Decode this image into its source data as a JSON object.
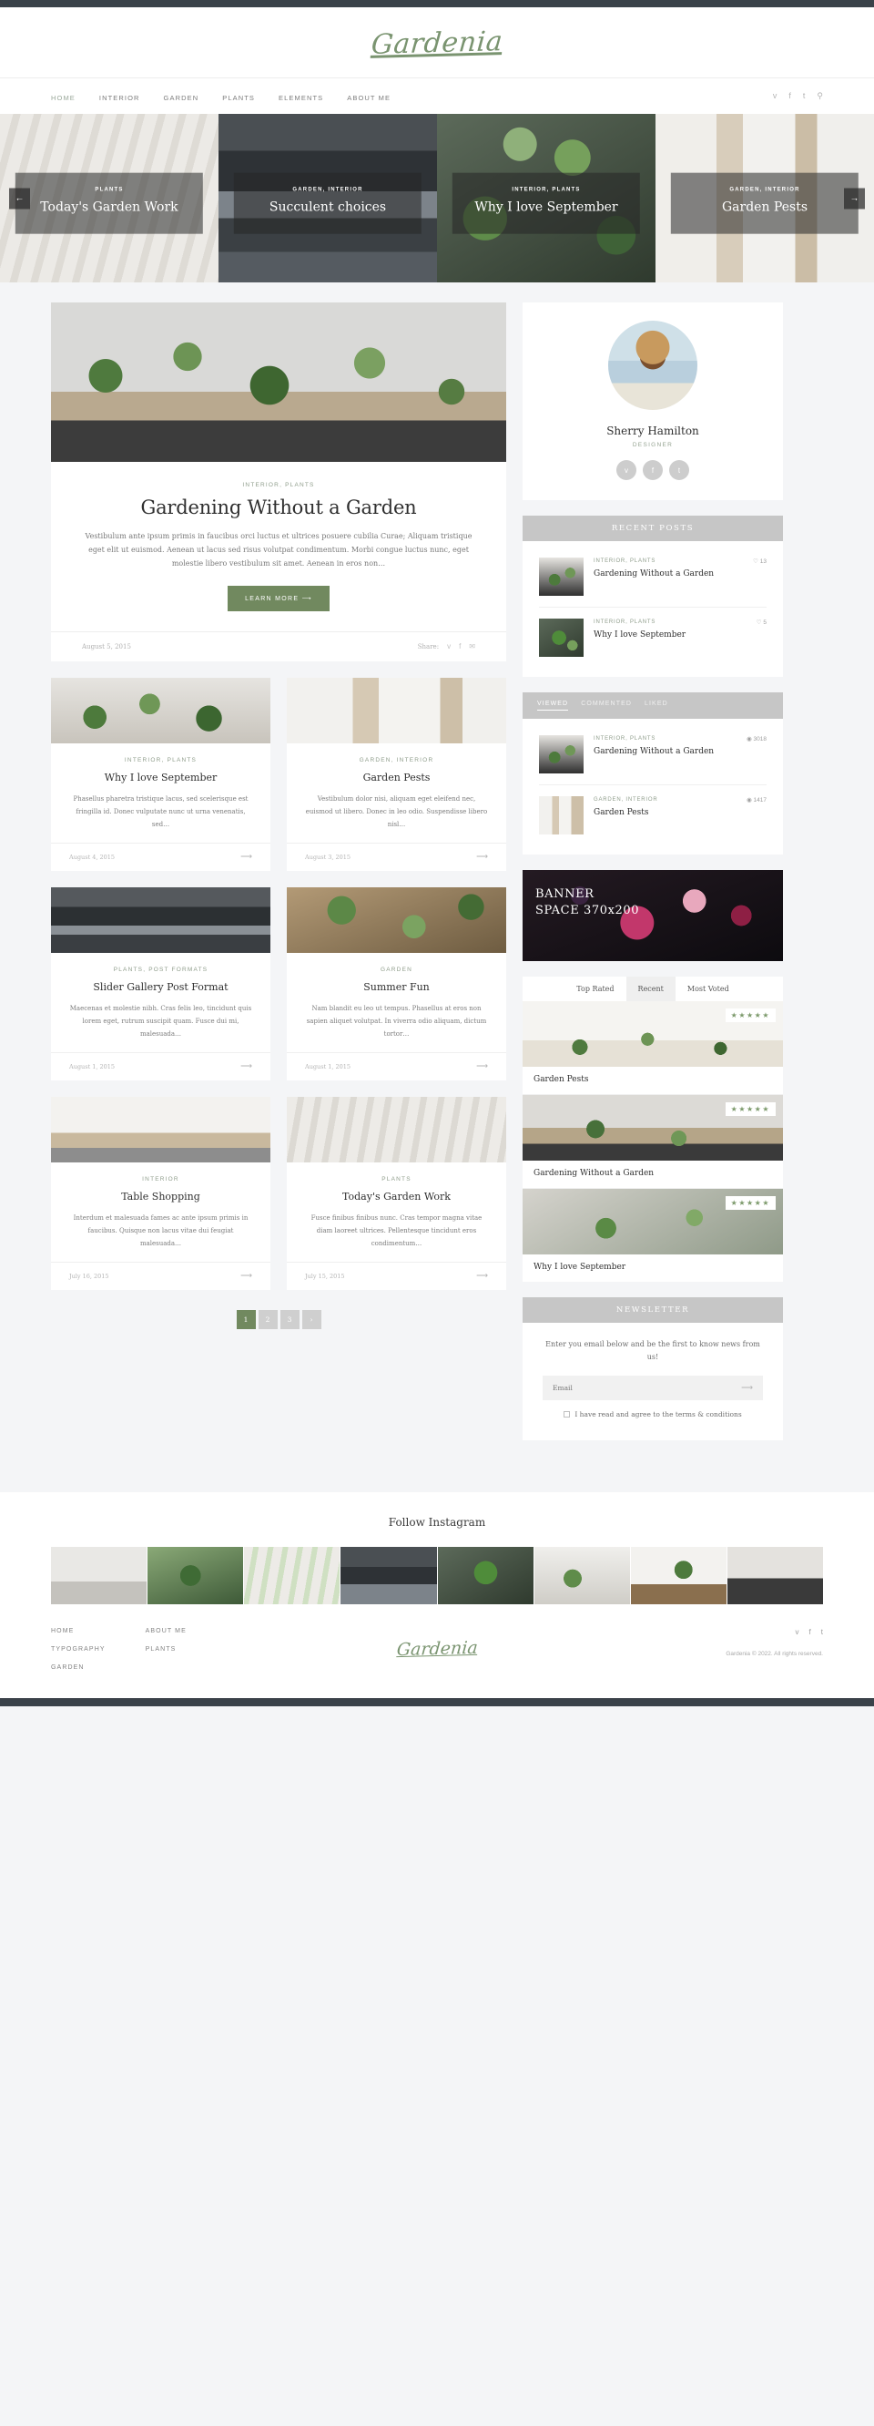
{
  "site": {
    "logo": "Gardenia",
    "footer_logo": "Gardenia"
  },
  "nav": {
    "items": [
      {
        "label": "HOME",
        "active": true
      },
      {
        "label": "INTERIOR",
        "active": false
      },
      {
        "label": "GARDEN",
        "active": false
      },
      {
        "label": "PLANTS",
        "active": false
      },
      {
        "label": "ELEMENTS",
        "active": false
      },
      {
        "label": "ABOUT ME",
        "active": false
      }
    ],
    "social": [
      {
        "name": "twitter-icon",
        "glyph": "ᴠ"
      },
      {
        "name": "facebook-icon",
        "glyph": "f"
      },
      {
        "name": "tumblr-icon",
        "glyph": "t"
      },
      {
        "name": "search-icon",
        "glyph": "⚲"
      }
    ]
  },
  "slider": {
    "prev_label": "←",
    "next_label": "→",
    "slides": [
      {
        "cat": "PLANTS",
        "title": "Today's Garden Work"
      },
      {
        "cat": "GARDEN, INTERIOR",
        "title": "Succulent choices"
      },
      {
        "cat": "INTERIOR, PLANTS",
        "title": "Why I love September"
      },
      {
        "cat": "GARDEN, INTERIOR",
        "title": "Garden Pests"
      }
    ]
  },
  "featured": {
    "cat": "INTERIOR, PLANTS",
    "title": "Gardening Without a Garden",
    "excerpt": "Vestibulum ante ipsum primis in faucibus orci luctus et ultrices posuere cubilia Curae; Aliquam tristique eget elit ut euismod. Aenean ut lacus sed risus volutpat condimentum. Morbi congue luctus nunc, eget molestie libero vestibulum sit amet. Aenean in eros non…",
    "button": "LEARN MORE  ⟶",
    "date": "August 5, 2015",
    "share_label": "Share:",
    "share": [
      {
        "name": "twitter-icon",
        "glyph": "ᴠ"
      },
      {
        "name": "facebook-icon",
        "glyph": "f"
      },
      {
        "name": "email-icon",
        "glyph": "✉"
      }
    ]
  },
  "posts": [
    {
      "cat": "INTERIOR, PLANTS",
      "title": "Why I love September",
      "excerpt": "Phasellus pharetra tristique lacus, sed scelerisque est fringilla id. Donec vulputate nunc ut urna venenatis, sed…",
      "date": "August 4, 2015",
      "arrow": "⟶"
    },
    {
      "cat": "GARDEN, INTERIOR",
      "title": "Garden Pests",
      "excerpt": "Vestibulum dolor nisi, aliquam eget eleifend nec, euismod ut libero. Donec in leo odio. Suspendisse libero nisl…",
      "date": "August 3, 2015",
      "arrow": "⟶"
    },
    {
      "cat": "PLANTS, POST FORMATS",
      "title": "Slider Gallery Post Format",
      "excerpt": "Maecenas et molestie nibh. Cras felis leo, tincidunt quis lorem eget, rutrum suscipit quam. Fusce dui mi, malesuada…",
      "date": "August 1, 2015",
      "arrow": "⟶"
    },
    {
      "cat": "GARDEN",
      "title": "Summer Fun",
      "excerpt": "Nam blandit eu leo ut tempus. Phasellus at eros non sapien aliquet volutpat. In viverra odio aliquam, dictum tortor…",
      "date": "August 1, 2015",
      "arrow": "⟶"
    },
    {
      "cat": "INTERIOR",
      "title": "Table Shopping",
      "excerpt": "Interdum et malesuada fames ac ante ipsum primis in faucibus. Quisque non lacus vitae dui feugiat malesuada…",
      "date": "July 16, 2015",
      "arrow": "⟶"
    },
    {
      "cat": "PLANTS",
      "title": "Today's Garden Work",
      "excerpt": "Fusce finibus finibus nunc. Cras tempor magna vitae diam laoreet ultrices. Pellentesque tincidunt eros condimentum…",
      "date": "July 15, 2015",
      "arrow": "⟶"
    }
  ],
  "pagination": {
    "pages": [
      "1",
      "2",
      "3",
      "›"
    ],
    "current": "1"
  },
  "sidebar": {
    "author": {
      "name": "Sherry Hamilton",
      "role": "DESIGNER",
      "social": [
        {
          "name": "twitter-icon",
          "glyph": "ᴠ"
        },
        {
          "name": "facebook-icon",
          "glyph": "f"
        },
        {
          "name": "tumblr-icon",
          "glyph": "t"
        }
      ]
    },
    "recent": {
      "title": "RECENT POSTS",
      "items": [
        {
          "cat": "INTERIOR, PLANTS",
          "title": "Gardening Without a Garden",
          "count": "♡ 13"
        },
        {
          "cat": "INTERIOR, PLANTS",
          "title": "Why I love September",
          "count": "♡ 5"
        }
      ]
    },
    "tabbed": {
      "tabs": [
        {
          "label": "VIEWED",
          "active": true
        },
        {
          "label": "COMMENTED",
          "active": false
        },
        {
          "label": "LIKED",
          "active": false
        }
      ],
      "items": [
        {
          "cat": "INTERIOR, PLANTS",
          "title": "Gardening Without a Garden",
          "count": "◉ 3018"
        },
        {
          "cat": "GARDEN, INTERIOR",
          "title": "Garden Pests",
          "count": "◉ 1417"
        }
      ]
    },
    "banner": {
      "line1": "BANNER",
      "line2": "SPACE 370x200"
    },
    "reviews": {
      "tabs": [
        {
          "label": "Top Rated",
          "active": true
        },
        {
          "label": "Recent",
          "active": false
        },
        {
          "label": "Most Voted",
          "active": false
        }
      ],
      "items": [
        {
          "title": "Garden Pests",
          "stars": "★★★★★"
        },
        {
          "title": "Gardening Without a Garden",
          "stars": "★★★★★"
        },
        {
          "title": "Why I love September",
          "stars": "★★★★★"
        }
      ]
    },
    "newsletter": {
      "title": "NEWSLETTER",
      "text": "Enter you email below and be the first to know news from us!",
      "placeholder": "Email",
      "email_value": "",
      "submit": "⟶",
      "consent": "I have read and agree to the terms & conditions"
    }
  },
  "instagram": {
    "title": "Follow Instagram"
  },
  "footer": {
    "col1": [
      {
        "label": "HOME"
      },
      {
        "label": "TYPOGRAPHY"
      },
      {
        "label": "GARDEN"
      }
    ],
    "col2": [
      {
        "label": "ABOUT ME"
      },
      {
        "label": "PLANTS"
      }
    ],
    "social": [
      {
        "name": "twitter-icon",
        "glyph": "ᴠ"
      },
      {
        "name": "facebook-icon",
        "glyph": "f"
      },
      {
        "name": "tumblr-icon",
        "glyph": "t"
      }
    ],
    "copyright": "Gardenia © 2022. All rights reserved."
  },
  "colors": {
    "accent": "#71895f",
    "logo": "#7a9470",
    "bar": "#3a4249",
    "widget_head": "#c6c6c6"
  }
}
